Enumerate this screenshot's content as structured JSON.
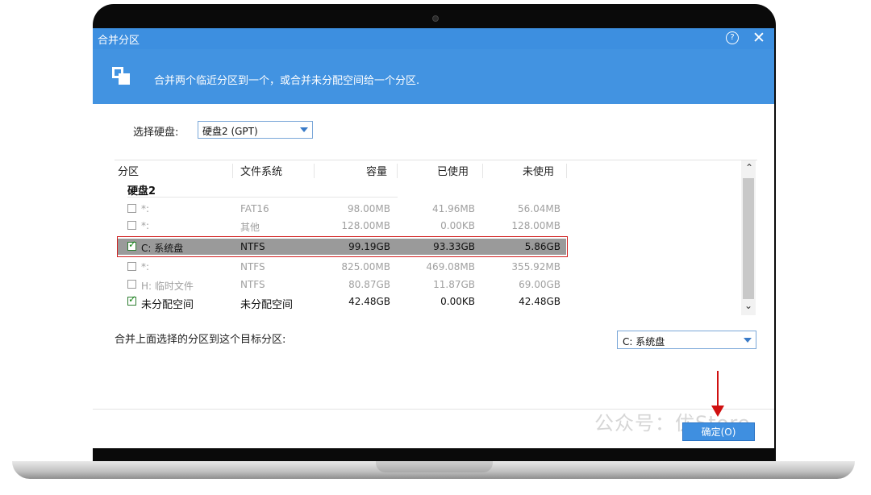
{
  "dialog": {
    "title": "合并分区",
    "help_icon": "question-icon",
    "close_glyph": "✕",
    "banner_text": "合并两个临近分区到一个，或合并未分配空间给一个分区."
  },
  "disk": {
    "label": "选择硬盘:",
    "value": "硬盘2 (GPT)"
  },
  "table": {
    "columns": [
      "分区",
      "文件系统",
      "容量",
      "已使用",
      "未使用"
    ],
    "group": "硬盘2",
    "rows": [
      {
        "checked": false,
        "name": "*:",
        "fs": "FAT16",
        "capacity": "98.00MB",
        "used": "41.96MB",
        "free": "56.04MB"
      },
      {
        "checked": false,
        "name": "*:",
        "fs": "其他",
        "capacity": "128.00MB",
        "used": "0.00KB",
        "free": "128.00MB"
      },
      {
        "checked": true,
        "name": "C: 系统盘",
        "fs": "NTFS",
        "capacity": "99.19GB",
        "used": "93.33GB",
        "free": "5.86GB"
      },
      {
        "checked": false,
        "name": "*:",
        "fs": "NTFS",
        "capacity": "825.00MB",
        "used": "469.08MB",
        "free": "355.92MB"
      },
      {
        "checked": false,
        "name": "H: 临时文件",
        "fs": "NTFS",
        "capacity": "80.87GB",
        "used": "11.87GB",
        "free": "69.00GB"
      },
      {
        "checked": true,
        "name": "未分配空间",
        "fs": "未分配空间",
        "capacity": "42.48GB",
        "used": "0.00KB",
        "free": "42.48GB"
      }
    ]
  },
  "target": {
    "label": "合并上面选择的分区到这个目标分区:",
    "value": "C: 系统盘"
  },
  "buttons": {
    "ok": "确定(O)"
  },
  "watermark": "公众号：优Store",
  "colors": {
    "titlebar": "#3d8fe0",
    "banner": "#4293e1",
    "selection": "#9a9a9a",
    "highlight_border": "#d02020",
    "arrow": "#d01010"
  }
}
